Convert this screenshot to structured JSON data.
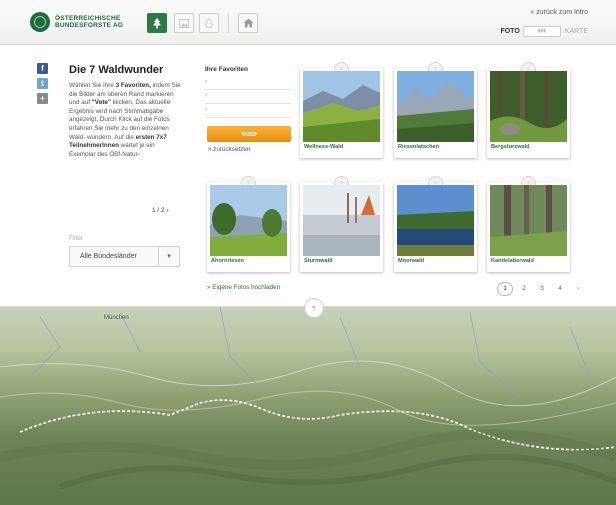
{
  "header": {
    "logo_line1": "ÖSTERREICHISCHE",
    "logo_line2": "BUNDESFORSTE AG",
    "back_link": "« zurück zum Intro",
    "foto_label": "FOTO",
    "karte_label": "KARTE"
  },
  "share": {
    "facebook": "f",
    "twitter": "t",
    "plus": "+"
  },
  "intro": {
    "title": "Die 7 Waldwunder",
    "text_1": "Wählen Sie Ihre ",
    "bold_1": "3 Favoriten,",
    "text_2": " indem Sie die Bilder am oberen Rand markieren und auf ",
    "bold_2": "\"Vote\"",
    "text_3": " klicken. Das aktuelle Ergebnis wird nach Stimmabgabe angezeigt. Durch Klick auf die Fotos erfahren Sie mehr zu den einzelnen Wald- wundern. Auf die ",
    "bold_3": "ersten 7x7 TeilnehmerInnen",
    "text_4": " wartet je ein Exemplar des ÖBf-Natur-",
    "pager": "1 / 2 ›"
  },
  "filter": {
    "label": "Filter",
    "selected": "Alle Bundesländer"
  },
  "favorites": {
    "title": "Ihre Favoriten",
    "slots": [
      "›",
      "›",
      "›"
    ],
    "vote_label": "Vote",
    "reset_label": "» zurücksetzen"
  },
  "cards": [
    {
      "caption": "Wellness-Wald",
      "image": "valley"
    },
    {
      "caption": "Riesenlatschen",
      "image": "mountain"
    },
    {
      "caption": "Bergsturzwald",
      "image": "forest"
    },
    {
      "caption": "Ahornriesen",
      "image": "meadow"
    },
    {
      "caption": "Sturmwald",
      "image": "misty"
    },
    {
      "caption": "Moorwald",
      "image": "lake"
    },
    {
      "caption": "Kandelaberwald",
      "image": "trunks"
    }
  ],
  "upload_link": "» Eigene Fotos hochladen",
  "pager": {
    "pages": [
      "1",
      "2",
      "3",
      "4"
    ],
    "current": "1",
    "next": "›"
  },
  "map": {
    "label_city": "München",
    "collapse_icon": "«"
  },
  "colors": {
    "brand_green": "#1f6b3f",
    "vote_orange": "#f0a020"
  }
}
